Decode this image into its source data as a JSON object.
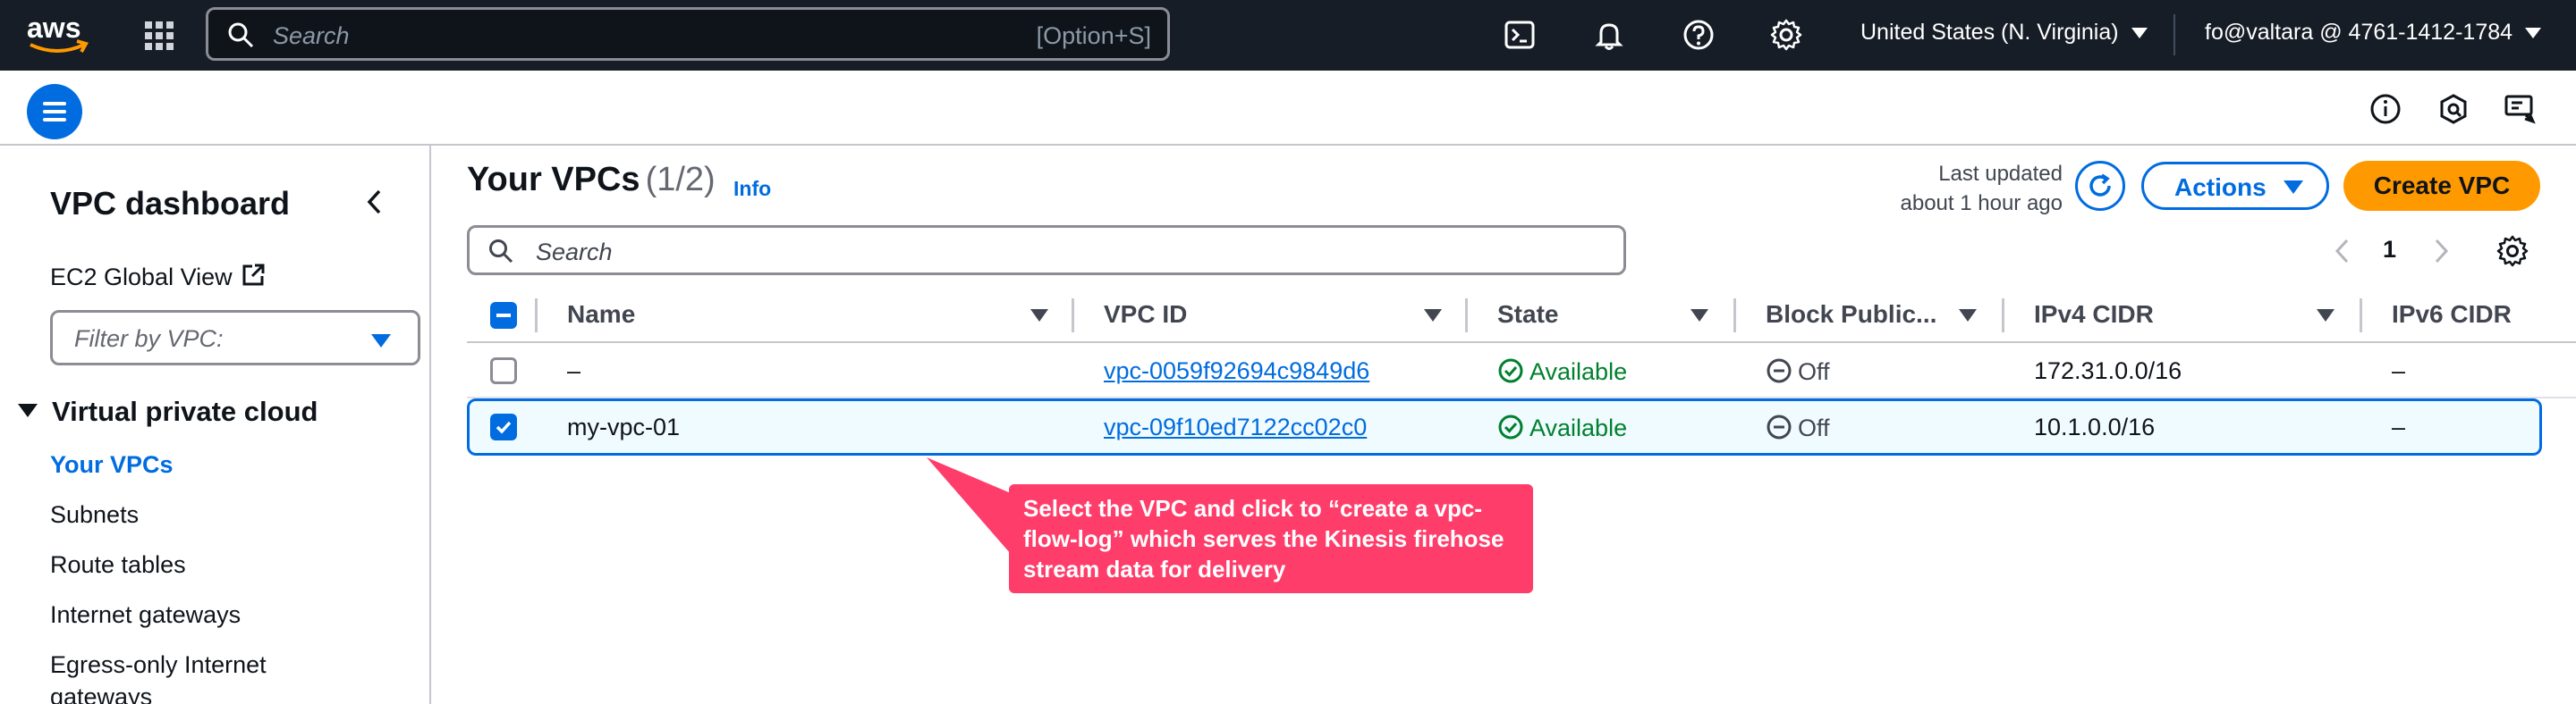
{
  "topnav": {
    "logo_text": "aws",
    "search_placeholder": "Search",
    "search_shortcut": "[Option+S]",
    "region": "United States (N. Virginia)",
    "account": "fo@valtara @ 4761-1412-1784"
  },
  "sidebar": {
    "title": "VPC dashboard",
    "ec2_global_view": "EC2 Global View",
    "filter_placeholder": "Filter by VPC:",
    "section": "Virtual private cloud",
    "items": [
      {
        "label": "Your VPCs",
        "active": true
      },
      {
        "label": "Subnets",
        "active": false
      },
      {
        "label": "Route tables",
        "active": false
      },
      {
        "label": "Internet gateways",
        "active": false
      },
      {
        "label": "Egress-only Internet",
        "active": false
      },
      {
        "label": "gateways",
        "active": false
      }
    ]
  },
  "main": {
    "title": "Your VPCs",
    "count": "(1/2)",
    "info": "Info",
    "last_updated_line1": "Last updated",
    "last_updated_line2": "about 1 hour ago",
    "actions_label": "Actions",
    "create_label": "Create VPC",
    "search_placeholder": "Search",
    "page_number": "1",
    "columns": [
      "Name",
      "VPC ID",
      "State",
      "Block Public...",
      "IPv4 CIDR",
      "IPv6 CIDR"
    ],
    "rows": [
      {
        "selected": false,
        "name": "–",
        "vpc_id": "vpc-0059f92694c9849d6",
        "state": "Available",
        "block_public": "Off",
        "ipv4": "172.31.0.0/16",
        "ipv6": "–"
      },
      {
        "selected": true,
        "name": "my-vpc-01",
        "vpc_id": "vpc-09f10ed7122cc02c0",
        "state": "Available",
        "block_public": "Off",
        "ipv4": "10.1.0.0/16",
        "ipv6": "–"
      }
    ]
  },
  "callout": {
    "text": "Select the VPC and click to “create a vpc-flow-log” which serves the Kinesis firehose stream data for delivery",
    "color": "#ff3d6a"
  },
  "colors": {
    "topnav_bg": "#161d26",
    "accent": "#006ce0",
    "primary_button": "#ff9900",
    "success": "#00802f"
  }
}
